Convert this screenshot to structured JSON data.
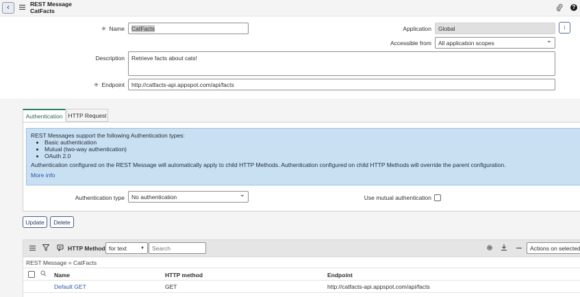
{
  "header": {
    "record_type": "REST Message",
    "record_name": "CatFacts",
    "back_symbol": "‹",
    "help_symbol": "?"
  },
  "form": {
    "name_label": "Name",
    "name_value": "CatFacts",
    "application_label": "Application",
    "application_value": "Global",
    "info_symbol": "i",
    "accessible_label": "Accessible from",
    "accessible_value": "All application scopes",
    "description_label": "Description",
    "description_value": "Retrieve facts about cats!",
    "endpoint_label": "Endpoint",
    "endpoint_value": "http://catfacts-api.appspot.com/api/facts"
  },
  "tabs": [
    {
      "label": "Authentication",
      "active": true
    },
    {
      "label": "HTTP Request",
      "active": false
    }
  ],
  "auth": {
    "intro": "REST Messages support the following Authentication types:",
    "types": [
      "Basic authentication",
      "Mutual (two-way authentication)",
      "OAuth 2.0"
    ],
    "note": "Authentication configured on the REST Message will automatically apply to child HTTP Methods. Authentication configured on child HTTP Methods will override the parent configuration.",
    "more_info": "More info",
    "auth_type_label": "Authentication type",
    "auth_type_value": "No authentication",
    "mutual_label": "Use mutual authentication",
    "mutual_checked": false
  },
  "actions": {
    "update_label": "Update",
    "delete_label": "Delete"
  },
  "related_list": {
    "title": "HTTP Methods",
    "filter_field": "for text",
    "search_placeholder": "Search",
    "actions_label": "Actions on selected r",
    "breadcrumb": "REST Message = CatFacts",
    "columns": [
      "Name",
      "HTTP method",
      "Endpoint"
    ],
    "rows": [
      {
        "name": "Default GET",
        "method": "GET",
        "endpoint": "http://catfacts-api.appspot.com/api/facts"
      }
    ]
  },
  "colors": {
    "tab_accent": "#278062",
    "link": "#2b57a8",
    "notice_bg": "#c9e0f2"
  }
}
